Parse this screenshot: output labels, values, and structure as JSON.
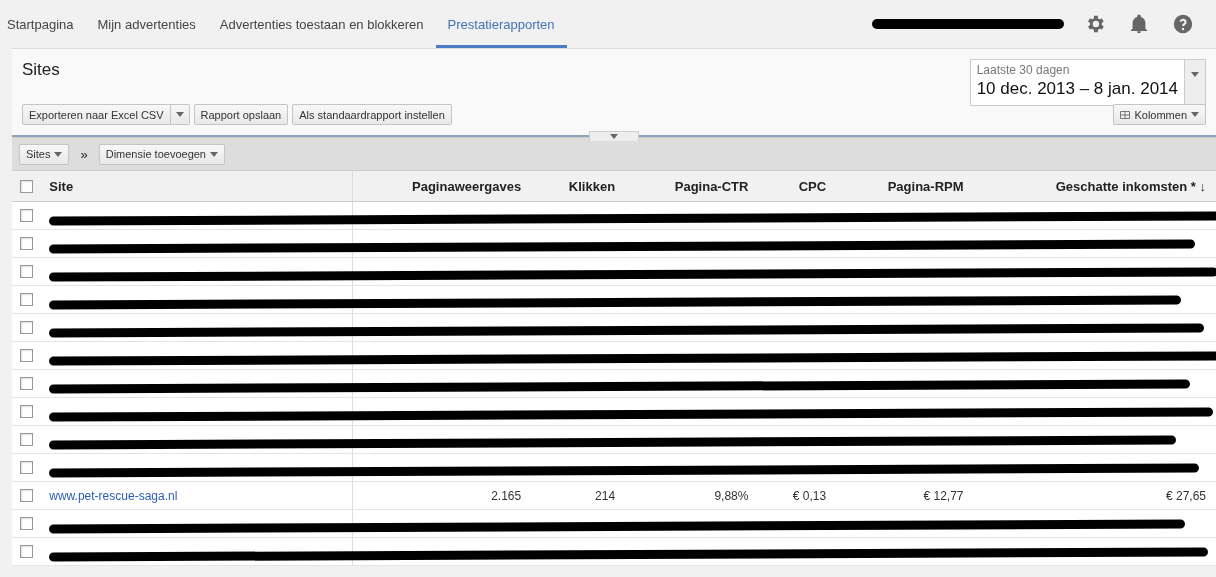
{
  "nav": {
    "tabs": [
      {
        "label": "Startpagina",
        "selected": false
      },
      {
        "label": "Mijn advertenties",
        "selected": false
      },
      {
        "label": "Advertenties toestaan en blokkeren",
        "selected": false
      },
      {
        "label": "Prestatierapporten",
        "selected": true
      }
    ],
    "account": {
      "redacted": true
    }
  },
  "report": {
    "title": "Sites",
    "date_range": {
      "label": "Laatste 30 dagen",
      "value": "10 dec. 2013 – 8 jan. 2014"
    },
    "buttons": [
      "Exporteren naar Excel CSV",
      "Rapport opslaan",
      "Als standaardrapport instellen"
    ],
    "columns_button": "Kolommen",
    "dimension": {
      "current": "Sites",
      "separator": "»",
      "add": "Dimensie toevoegen"
    }
  },
  "table": {
    "select_all": {
      "checked": false
    },
    "columns": [
      "Site",
      "Paginaweergaves",
      "Klikken",
      "Pagina-CTR",
      "CPC",
      "Pagina-RPM",
      "Geschatte inkomsten *"
    ],
    "sort_marker": "↓",
    "rows": [
      {
        "redacted": true,
        "checked": false
      },
      {
        "redacted": true,
        "checked": false
      },
      {
        "redacted": true,
        "checked": false
      },
      {
        "redacted": true,
        "checked": false
      },
      {
        "redacted": true,
        "checked": false
      },
      {
        "redacted": true,
        "checked": false
      },
      {
        "redacted": true,
        "checked": false
      },
      {
        "redacted": true,
        "checked": false
      },
      {
        "redacted": true,
        "checked": false
      },
      {
        "redacted": true,
        "checked": false
      },
      {
        "redacted": false,
        "checked": false,
        "cells": [
          "www.pet-rescue-saga.nl",
          "2.165",
          "214",
          "9,88%",
          "€ 0,13",
          "€ 12,77",
          "€ 27,65"
        ]
      },
      {
        "redacted": true,
        "checked": false
      },
      {
        "redacted": true,
        "checked": false
      }
    ]
  }
}
